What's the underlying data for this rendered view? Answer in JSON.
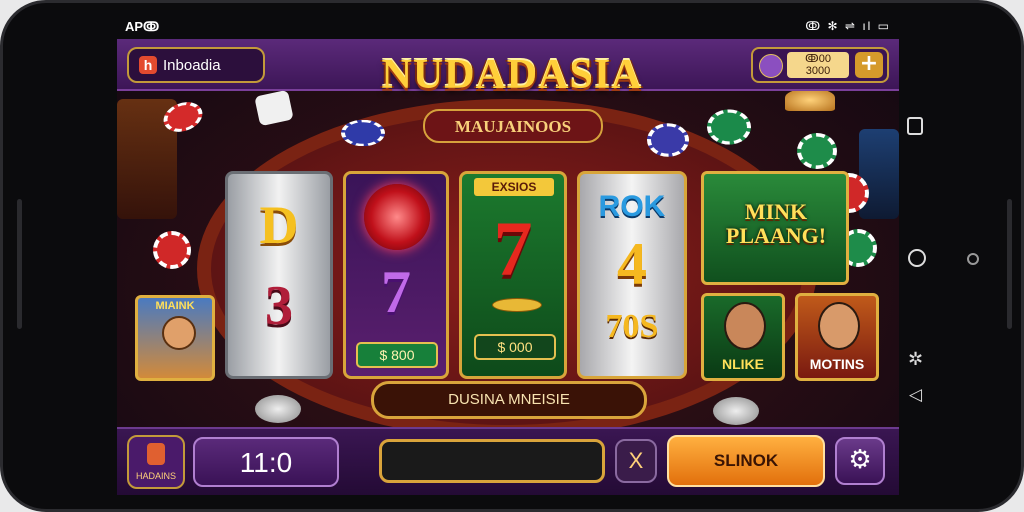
{
  "status_bar": {
    "time": "APↂ",
    "icons": "ↂ ✻ ⇌ ıl ▭"
  },
  "brand": {
    "logo": "h",
    "name": "Inboadia"
  },
  "balance": {
    "line1": "ↂ00",
    "line2": "3000",
    "add_label": "+"
  },
  "game": {
    "title": "NUDADASIA",
    "subtitle": "MAUJAINOOS"
  },
  "reels": [
    {
      "top": "D",
      "bottom": "3"
    },
    {
      "top": "",
      "bottom": "7",
      "value": "$ 800"
    },
    {
      "header": "EXSIOS",
      "middle": "7",
      "value": "$ 000"
    },
    {
      "top": "ROK",
      "middle": "4",
      "bottom": "70S"
    }
  ],
  "promo": {
    "text": "MINK PLAANG!"
  },
  "side_tiles": [
    {
      "label": "MIAINK"
    },
    {
      "label": "NLIKE"
    },
    {
      "label": "MOTINS"
    }
  ],
  "banner": {
    "text": "DUSINA MNEISIE"
  },
  "bottom": {
    "profile_label": "HADAINS",
    "bet_value": "11:0",
    "close_label": "X",
    "spin_label": "SLINOK",
    "settings_icon": "gear-icon"
  },
  "colors": {
    "accent": "#ffcf3a",
    "spin": "#f6921e",
    "felt": "#8e1e1b",
    "ui_purple": "#3d1657"
  }
}
